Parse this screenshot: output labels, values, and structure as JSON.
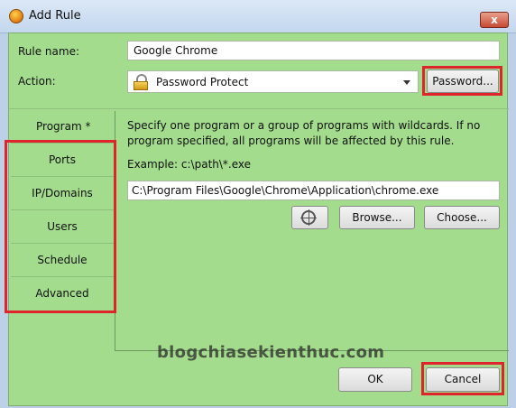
{
  "window": {
    "title": "Add Rule",
    "close_glyph": "x"
  },
  "form": {
    "rule_name_label": "Rule name:",
    "rule_name_value": "Google Chrome",
    "action_label": "Action:",
    "action_value": "Password Protect",
    "password_button": "Password..."
  },
  "nav": {
    "selected": "Program *",
    "items": [
      "Ports",
      "IP/Domains",
      "Users",
      "Schedule",
      "Advanced"
    ]
  },
  "program": {
    "description": "Specify one program or a group of programs with wildcards. If no program specified, all programs will be affected by this rule.",
    "example": "Example: c:\\path\\*.exe",
    "path_value": "C:\\Program Files\\Google\\Chrome\\Application\\chrome.exe",
    "browse_button": "Browse...",
    "choose_button": "Choose..."
  },
  "footer": {
    "ok_button": "OK",
    "cancel_button": "Cancel"
  },
  "watermark": "blogchiasekienthuc.com",
  "colors": {
    "panel": "#a4dc8e",
    "highlight": "#e0242c",
    "titlebar": "#c4d7ee"
  },
  "icons": [
    "app-icon",
    "lock-icon",
    "dropdown-arrow-icon",
    "crosshair-target-icon",
    "close-icon"
  ]
}
